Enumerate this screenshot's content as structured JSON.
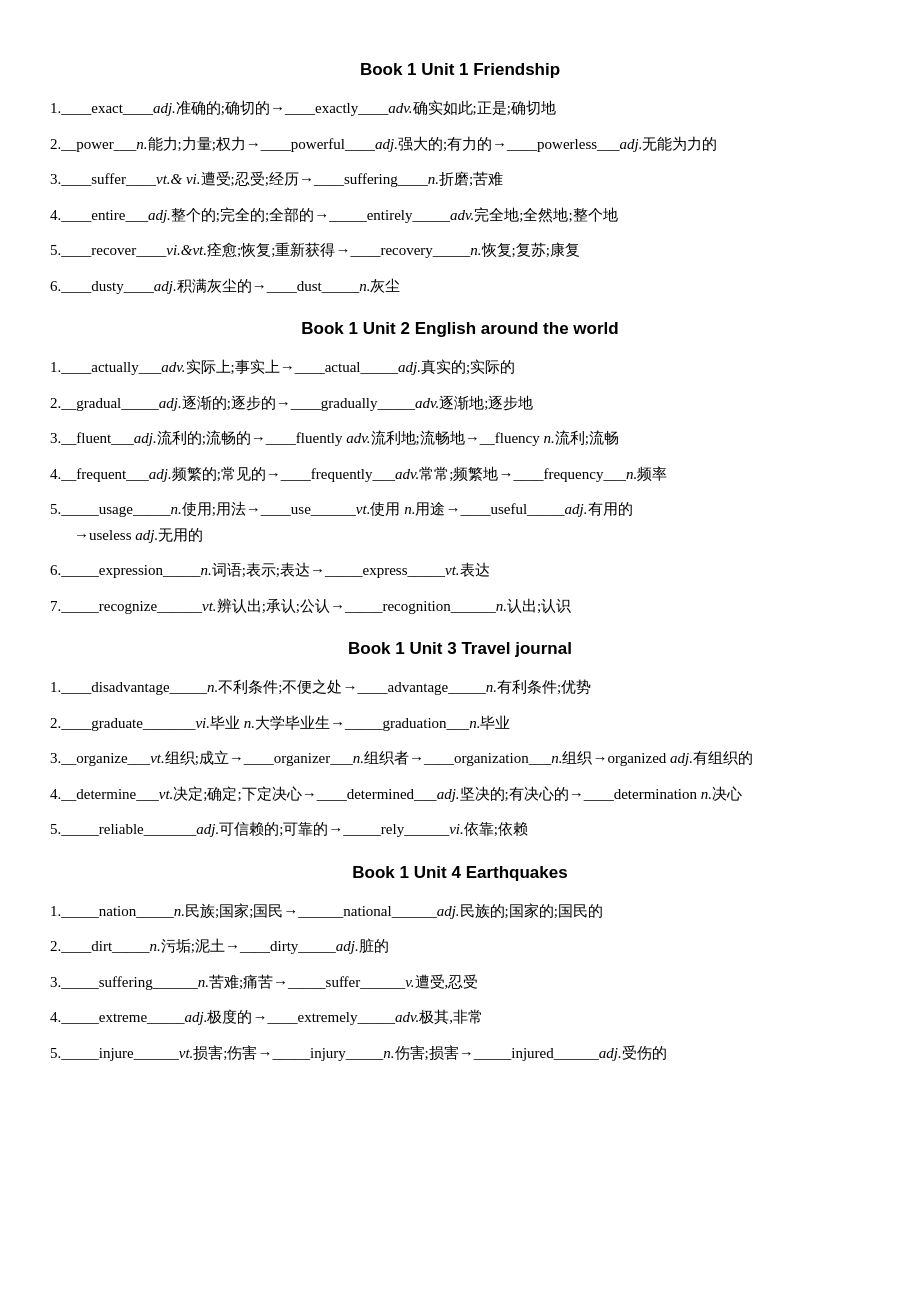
{
  "sections": [
    {
      "title": "Book 1    Unit 1    Friendship",
      "entries": [
        "1.____exact____<em>adj.</em>准确的;确切的→____exactly____<em>adv.</em>确实如此;正是;确切地",
        "2.__power___<em>n.</em>能力;力量;权力→____powerful____<em>adj.</em>强大的;有力的→____powerless___<em>adj.</em>无能为力的",
        "3.____suffer____<em>vt.&amp; vi.</em>遭受;忍受;经历→____suffering____<em>n.</em>折磨;苦难",
        "4.____entire___<em>adj.</em>整个的;完全的;全部的→_____entirely_____<em>adv.</em>完全地;全然地;整个地",
        "5.____recover____<em>vi.&amp;vt.</em>痊愈;恢复;重新获得→____recovery_____<em>n.</em>恢复;复苏;康复",
        "6.____dusty____<em>adj.</em>积满灰尘的→____dust_____<em>n.</em>灰尘"
      ]
    },
    {
      "title": "Book 1    Unit 2    English around the world",
      "entries": [
        "1.____actually___<em>adv.</em>实际上;事实上→____actual_____<em>adj.</em>真实的;实际的",
        "2.__gradual_____<em>adj.</em>逐渐的;逐步的→____gradually_____<em>adv.</em>逐渐地;逐步地",
        "3.__fluent___<em>adj.</em>流利的;流畅的→____fluently <em>adv.</em>流利地;流畅地→__fluency <em>n.</em>流利;流畅",
        "4.__frequent___<em>adj.</em>频繁的;常见的→____frequently___<em>adv.</em>常常;频繁地→____frequency___<em>n.</em>频率",
        "5._____usage_____<em>n.</em>使用;用法→____use______<em>vt.</em>使用 <em>n.</em>用途→____useful_____<em>adj.</em>有用的\n→useless <em>adj.</em>无用的",
        "6._____expression_____<em>n.</em>词语;表示;表达→_____express_____<em>vt.</em>表达",
        "7._____recognize______<em>vt.</em>辨认出;承认;公认→_____recognition______<em>n.</em>认出;认识"
      ]
    },
    {
      "title": "Book 1    Unit 3    Travel journal",
      "entries": [
        "1.____disadvantage_____<em>n.</em>不利条件;不便之处→____advantage_____<em>n.</em>有利条件;优势",
        "2.____graduate_______<em>vi.</em>毕业 <em>n.</em>大学毕业生→_____graduation___<em>n.</em>毕业",
        "3.__organize___<em>vt.</em>组织;成立→____organizer___<em>n.</em>组织者→____organization___<em>n.</em>组织→organized <em>adj.</em>有组织的",
        "4.__determine___<em>vt.</em>决定;确定;下定决心→____determined___<em>adj.</em>坚决的;有决心的→____determination <em>n.</em>决心",
        "5._____reliable_______<em>adj.</em>可信赖的;可靠的→_____rely______<em>vi.</em>依靠;依赖"
      ]
    },
    {
      "title": "Book 1    Unit 4    Earthquakes",
      "entries": [
        "1._____nation_____<em>n.</em>民族;国家;国民→______national______<em>adj.</em>民族的;国家的;国民的",
        "2.____dirt_____<em>n.</em>污垢;泥土→____dirty_____<em>adj.</em>脏的",
        "3._____suffering______<em>n.</em>苦难;痛苦→_____suffer______<em>v.</em>遭受,忍受",
        "4._____extreme_____<em>adj.</em>极度的→____extremely_____<em>adv.</em>极其,非常",
        "5._____injure______<em>vt.</em>损害;伤害→_____injury_____<em>n.</em>伤害;损害→_____injured______<em>adj.</em>受伤的"
      ]
    }
  ]
}
